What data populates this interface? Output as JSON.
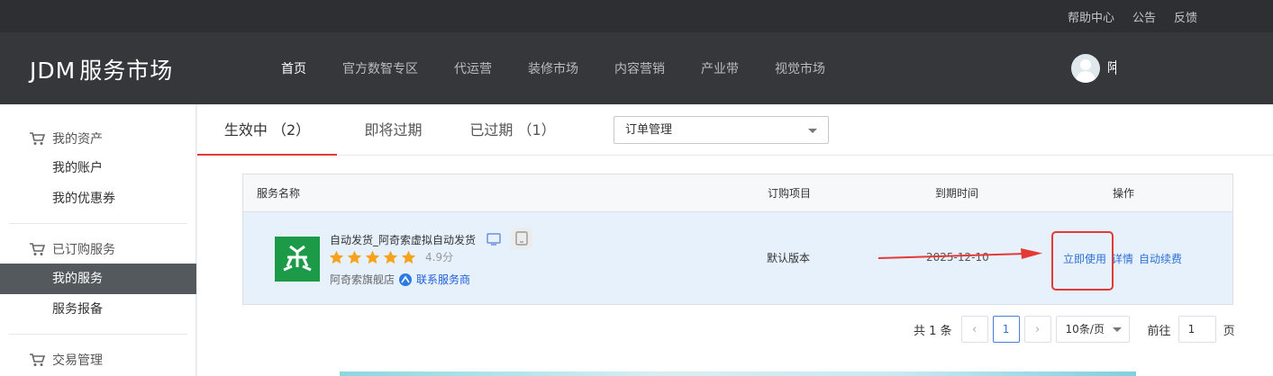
{
  "topbar": {
    "links": [
      "帮助中心",
      "公告",
      "反馈"
    ]
  },
  "header": {
    "logo_prefix": "JDM",
    "logo_text": "服务市场",
    "nav": [
      "首页",
      "官方数智专区",
      "代运营",
      "装修市场",
      "内容营销",
      "产业带",
      "视觉市场"
    ],
    "active_nav": "首页",
    "username": "阿"
  },
  "sidebar": {
    "groups": [
      {
        "title": "我的资产",
        "icon": "cart-icon",
        "items": [
          "我的账户",
          "我的优惠券"
        ]
      },
      {
        "title": "已订购服务",
        "icon": "cart-icon",
        "items": [
          "我的服务",
          "服务报备"
        ]
      },
      {
        "title": "交易管理",
        "icon": "cart-icon",
        "items": []
      }
    ],
    "active_item": "我的服务"
  },
  "tabs": [
    {
      "label": "生效中 （2）",
      "active": true
    },
    {
      "label": "即将过期",
      "active": false
    },
    {
      "label": "已过期 （1）",
      "active": false
    }
  ],
  "filter_select": {
    "value": "订单管理"
  },
  "table": {
    "headers": {
      "name": "服务名称",
      "item": "订购项目",
      "expiry": "到期时间",
      "actions": "操作"
    },
    "rows": [
      {
        "name": "自动发货_阿奇索虚拟自动发货",
        "rating": 4.9,
        "rating_label": "4.9分",
        "vendor": "阿奇索旗舰店",
        "contact": "联系服务商",
        "version": "默认版本",
        "expiry": "2025-12-10",
        "actions": [
          "立即使用",
          "详情",
          "自动续费"
        ]
      }
    ]
  },
  "pagination": {
    "total_label": "共 1 条",
    "current_page": "1",
    "page_size": "10条/页",
    "goto_prefix": "前往",
    "goto_value": "1",
    "goto_suffix": "页"
  },
  "colors": {
    "accent_red": "#e4393c",
    "link_blue": "#2f6fd6",
    "app_green": "#1d9a47",
    "star_orange": "#f7a21c"
  }
}
